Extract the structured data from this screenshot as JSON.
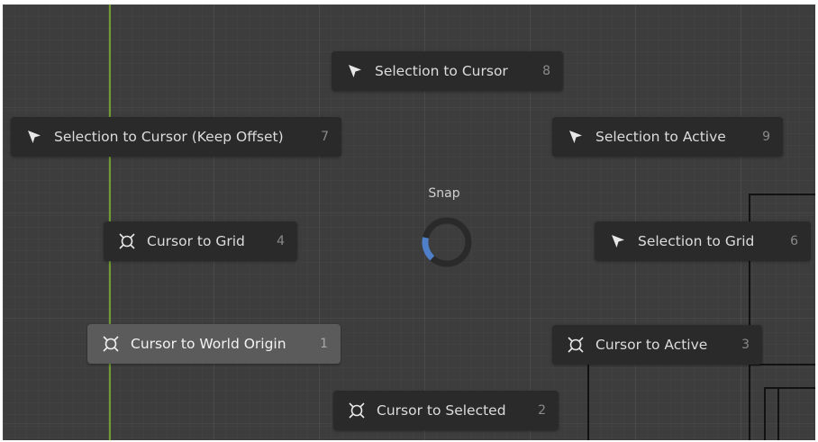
{
  "pie_menu": {
    "title": "Snap",
    "items": [
      {
        "label": "Selection to Cursor",
        "hotkey": "8",
        "icon": "cursor-arrow-icon",
        "active": false
      },
      {
        "label": "Selection to Cursor (Keep Offset)",
        "hotkey": "7",
        "icon": "cursor-arrow-icon",
        "active": false
      },
      {
        "label": "Selection to Active",
        "hotkey": "9",
        "icon": "cursor-arrow-icon",
        "active": false
      },
      {
        "label": "Cursor to Grid",
        "hotkey": "4",
        "icon": "3d-cursor-icon",
        "active": false
      },
      {
        "label": "Selection to Grid",
        "hotkey": "6",
        "icon": "cursor-arrow-icon",
        "active": false
      },
      {
        "label": "Cursor to World Origin",
        "hotkey": "1",
        "icon": "3d-cursor-icon",
        "active": true
      },
      {
        "label": "Cursor to Active",
        "hotkey": "3",
        "icon": "3d-cursor-icon",
        "active": false
      },
      {
        "label": "Cursor to Selected",
        "hotkey": "2",
        "icon": "3d-cursor-icon",
        "active": false
      }
    ]
  },
  "colors": {
    "viewport_bg": "#3d3d3d",
    "item_bg": "#2a2a2a",
    "item_active_bg": "#5b5b5b",
    "y_axis": "#6f9b2f",
    "pie_indicator": "#4f7fc8"
  }
}
